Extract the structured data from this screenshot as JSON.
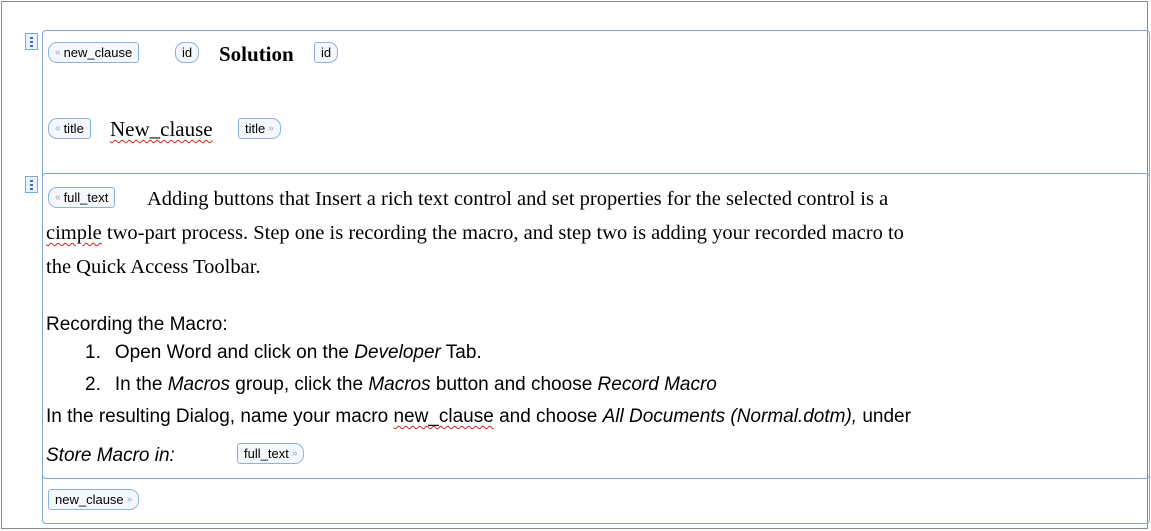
{
  "new_clause": {
    "open_tag": "new_clause",
    "close_tag": "new_clause",
    "id": {
      "open_tag": "id",
      "value": "Solution",
      "close_tag": "id"
    },
    "title": {
      "open_tag": "title",
      "value": "New_clause",
      "close_tag": "title"
    }
  },
  "full_text": {
    "open_tag": "full_text",
    "close_tag": "full_text",
    "para1": {
      "line1": "Adding buttons that Insert a rich text control and set properties for the selected control is a",
      "line2_word": "cimple",
      "line2_rest": " two-part process.  Step one is recording the macro, and step two is adding your recorded macro to",
      "line3": "the Quick Access Toolbar."
    },
    "heading": "Recording the Macro:",
    "step1": {
      "num": "1.",
      "pre": "Open Word and click on the ",
      "em": "Developer",
      "post": " Tab."
    },
    "step2": {
      "num": "2.",
      "pre": "In the ",
      "em1": "Macros",
      "mid": " group, click the ",
      "em2": "Macros",
      "mid2": " button and choose ",
      "em3": "Record Macro"
    },
    "dialog": {
      "pre": "In the resulting Dialog, name your macro ",
      "macro": "new_clause",
      "mid": " and choose ",
      "em": "All Documents (Normal.dotm),",
      "post": " under"
    },
    "store": "Store Macro in:"
  },
  "colors": {
    "control_border": "#7fa7d9",
    "spell_underline": "#d42020"
  }
}
